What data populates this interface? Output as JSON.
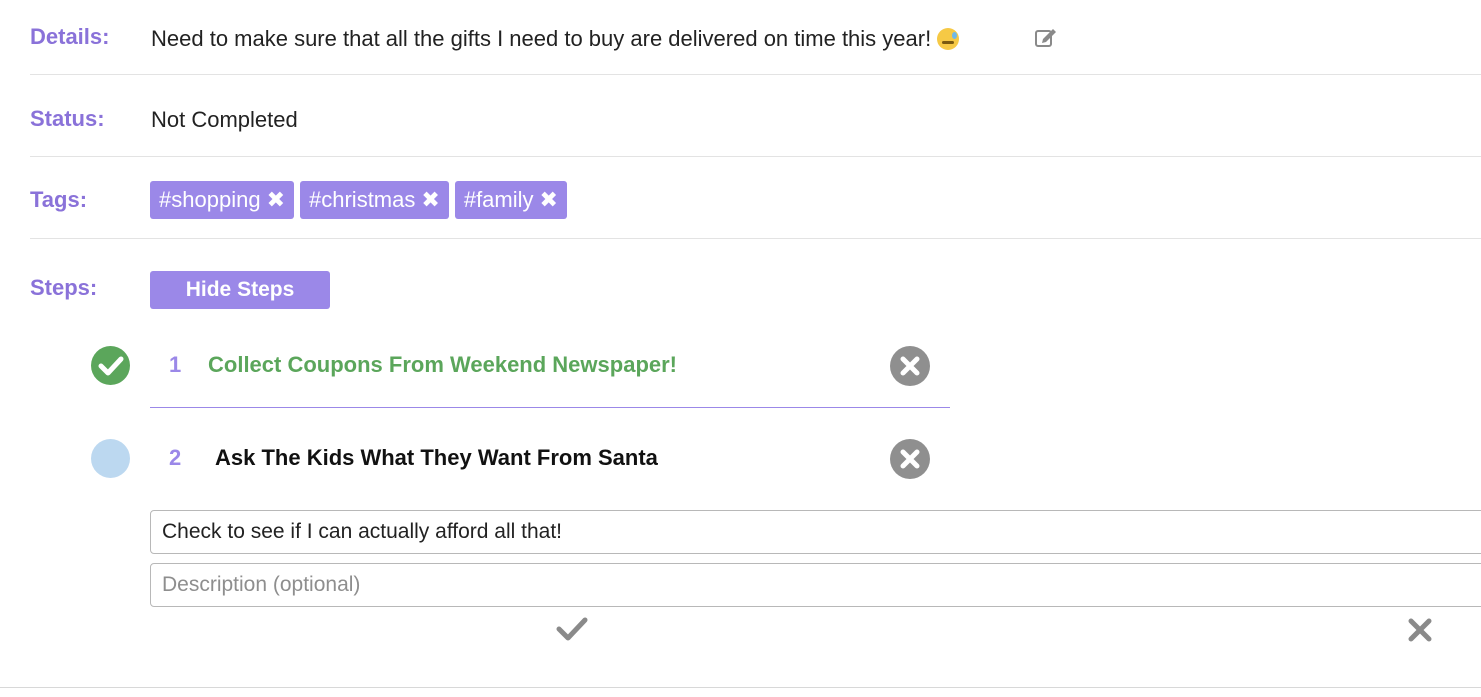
{
  "details": {
    "label": "Details:",
    "text": "Need to make sure that all the gifts I need to buy are delivered on time this year!",
    "emoji_icon": "downcast-face-with-sweat-icon",
    "edit_icon": "edit-icon"
  },
  "status": {
    "label": "Status:",
    "value": "Not Completed"
  },
  "tags": {
    "label": "Tags:",
    "items": [
      {
        "hash": "#",
        "name": "shopping",
        "remove": "✖"
      },
      {
        "hash": "#",
        "name": "christmas",
        "remove": "✖"
      },
      {
        "hash": "#",
        "name": "family",
        "remove": "✖"
      }
    ]
  },
  "steps": {
    "label": "Steps:",
    "toggle_label": "Hide Steps",
    "items": [
      {
        "number": "1",
        "title": "Collect Coupons From Weekend Newspaper!",
        "completed": true
      },
      {
        "number": "2",
        "title": "Ask The Kids What They Want From Santa",
        "completed": false
      }
    ],
    "new_step": {
      "title_value": "Check to see if I can actually afford all that!",
      "description_placeholder": "Description (optional)"
    }
  },
  "colors": {
    "accent": "#9b88e8",
    "label": "#8a72d9",
    "completed": "#5ba65b",
    "pending_circle": "#bcd8f0",
    "delete_icon": "#8f8f8f"
  }
}
